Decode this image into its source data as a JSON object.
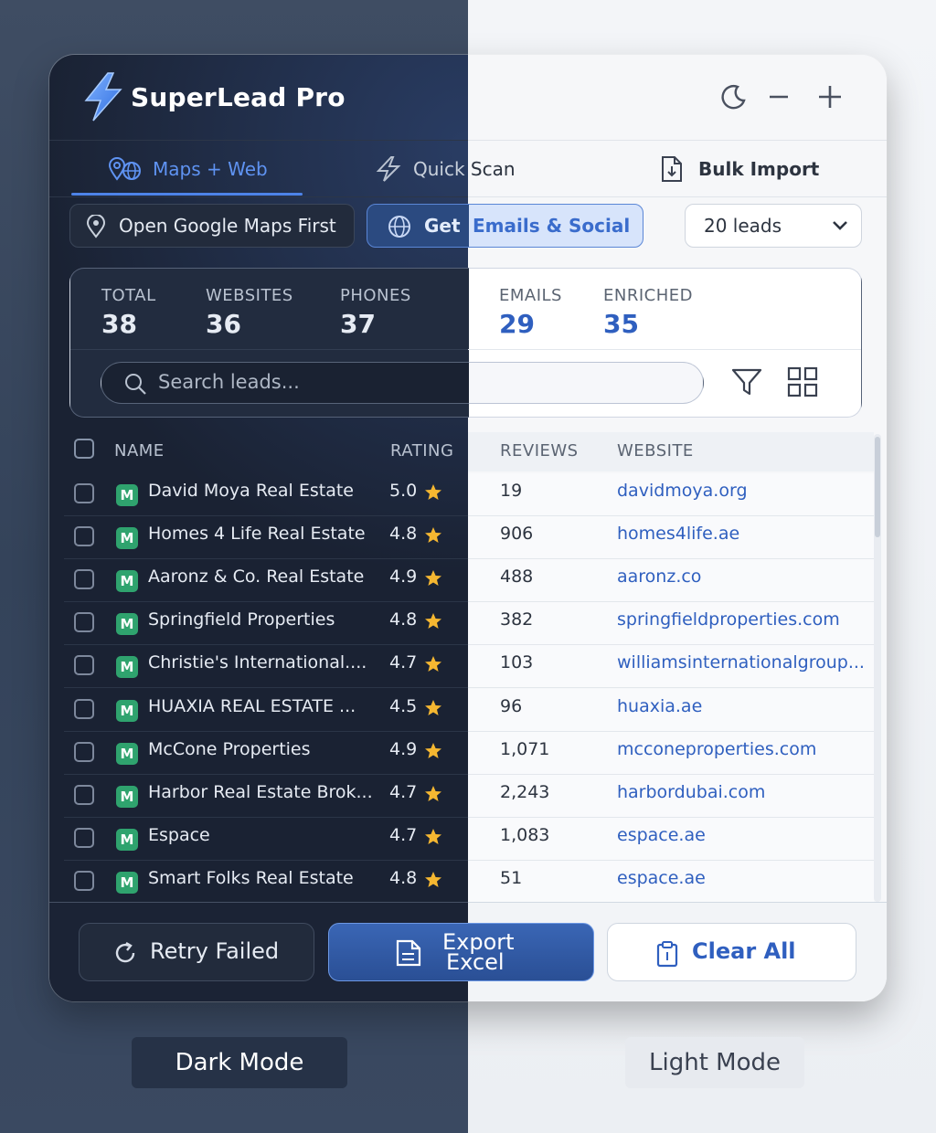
{
  "app": {
    "title": "SuperLead Pro"
  },
  "window_controls": [
    "moon-icon",
    "minimize-icon",
    "pin-icon"
  ],
  "tabs": [
    {
      "label": "Maps + Web",
      "icon": "map-globe-icon",
      "active": true
    },
    {
      "label": "Quick Scan",
      "icon": "lightning-icon",
      "active": false
    },
    {
      "label": "Bulk Import",
      "icon": "file-import-icon",
      "active": false
    }
  ],
  "actions": {
    "open_maps": "Open Google Maps First",
    "get_emails": "Get Emails & Social",
    "leads_select": "20 leads"
  },
  "stats": [
    {
      "label": "TOTAL",
      "value": "38"
    },
    {
      "label": "WEBSITES",
      "value": "36"
    },
    {
      "label": "PHONES",
      "value": "37"
    },
    {
      "label": "EMAILS",
      "value": "29"
    },
    {
      "label": "ENRICHED",
      "value": "35"
    }
  ],
  "search": {
    "placeholder": "Search leads..."
  },
  "table": {
    "headers": {
      "name": "NAME",
      "rating": "RATING",
      "reviews": "REVIEWS",
      "website": "WEBSITE"
    },
    "rows": [
      {
        "badge": "M",
        "name": "David Moya Real Estate",
        "rating": "5.0",
        "reviews": "19",
        "website": "davidmoya.org"
      },
      {
        "badge": "M",
        "name": "Homes 4 Life Real Estate",
        "rating": "4.8",
        "reviews": "906",
        "website": "homes4life.ae"
      },
      {
        "badge": "M",
        "name": "Aaronz & Co. Real Estate",
        "rating": "4.9",
        "reviews": "488",
        "website": "aaronz.co"
      },
      {
        "badge": "M",
        "name": "Springfield Properties",
        "rating": "4.8",
        "reviews": "382",
        "website": "springfieldproperties.com"
      },
      {
        "badge": "M",
        "name": "Christie's International....",
        "rating": "4.7",
        "reviews": "103",
        "website": "williamsinternationalgroup..."
      },
      {
        "badge": "M",
        "name": "HUAXIA REAL ESTATE ...",
        "rating": "4.5",
        "reviews": "96",
        "website": "huaxia.ae"
      },
      {
        "badge": "M",
        "name": "McCone Properties",
        "rating": "4.9",
        "reviews": "1,071",
        "website": "mcconeproperties.com"
      },
      {
        "badge": "M",
        "name": "Harbor Real Estate Brok...",
        "rating": "4.7",
        "reviews": "2,243",
        "website": "harbordubai.com"
      },
      {
        "badge": "M",
        "name": "Espace",
        "rating": "4.7",
        "reviews": "1,083",
        "website": "espace.ae"
      },
      {
        "badge": "M",
        "name": "Smart Folks Real Estate",
        "rating": "4.8",
        "reviews": "51",
        "website": "espace.ae"
      }
    ]
  },
  "buttons": {
    "retry": "Retry Failed",
    "export_line1": "Export",
    "export_line2": "Excel",
    "clear": "Clear All"
  },
  "modes": {
    "dark": "Dark Mode",
    "light": "Light Mode"
  },
  "colors": {
    "accent": "#4d83e8",
    "badge_green": "#2fa36e",
    "star": "#f5b731",
    "link_light": "#2f5fbf",
    "link_dark": "#5f93f2"
  }
}
